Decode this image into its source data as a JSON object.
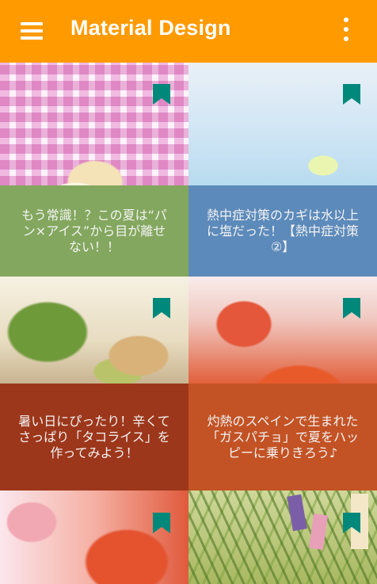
{
  "app_bar": {
    "title": "Material Design",
    "background": "#ff9a00",
    "menu_icon": "hamburger-menu-icon",
    "overflow_icon": "more-vert-icon"
  },
  "bookmark_color": "#00897b",
  "cards": [
    {
      "caption": "もう常識！？この夏は“パン×アイス”から目が離せない！！",
      "image": "shaved-ice"
    },
    {
      "caption": "熱中症対策のカギは水以上に塩だった！【熱中症対策②】",
      "image": "glass-of-water"
    },
    {
      "caption": "暑い日にぴったり！辛くてさっぱり「タコライス」を作ってみよう！",
      "image": "taco-rice"
    },
    {
      "caption": "灼熱のスペインで生まれた「ガスパチョ」で夏をハッピーに乗りきろう♪",
      "image": "gazpacho"
    },
    {
      "caption": "",
      "image": "watermelon"
    },
    {
      "caption": "",
      "image": "tanabata-bamboo"
    }
  ]
}
